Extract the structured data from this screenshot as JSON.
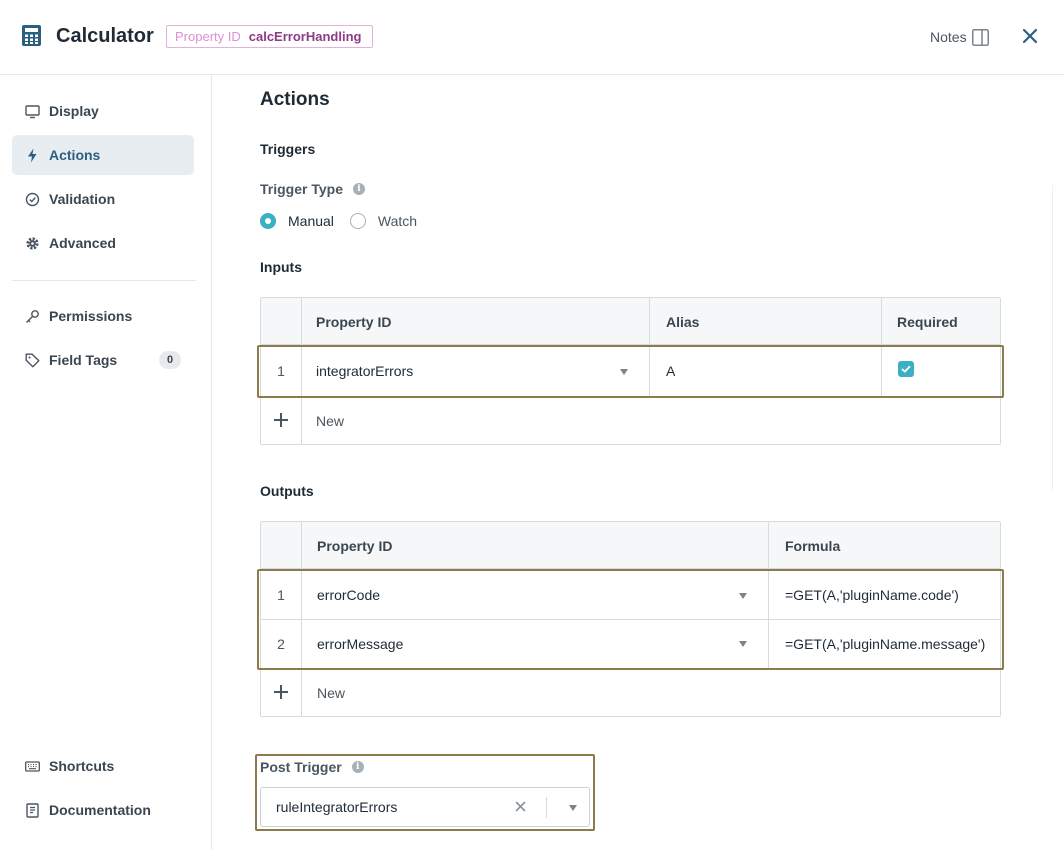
{
  "header": {
    "title": "Calculator",
    "property_key": "Property ID",
    "property_value": "calcErrorHandling",
    "notes_label": "Notes"
  },
  "sidebar": {
    "items": [
      {
        "label": "Display",
        "icon": "monitor-icon"
      },
      {
        "label": "Actions",
        "icon": "lightning-icon",
        "active": true
      },
      {
        "label": "Validation",
        "icon": "check-circle-icon"
      },
      {
        "label": "Advanced",
        "icon": "gear-icon"
      },
      {
        "label": "Permissions",
        "icon": "key-icon"
      },
      {
        "label": "Field Tags",
        "icon": "tag-icon",
        "count": "0"
      },
      {
        "label": "Shortcuts",
        "icon": "keyboard-icon"
      },
      {
        "label": "Documentation",
        "icon": "book-icon"
      }
    ]
  },
  "main": {
    "title": "Actions",
    "triggers_heading": "Triggers",
    "trigger_type_label": "Trigger Type",
    "trigger_options": [
      "Manual",
      "Watch"
    ],
    "trigger_selected": "Manual",
    "inputs": {
      "heading": "Inputs",
      "columns": [
        "Property ID",
        "Alias",
        "Required"
      ],
      "rows": [
        {
          "num": "1",
          "property_id": "integratorErrors",
          "alias": "A",
          "required": true
        }
      ],
      "new_label": "New"
    },
    "outputs": {
      "heading": "Outputs",
      "columns": [
        "Property ID",
        "Formula"
      ],
      "rows": [
        {
          "num": "1",
          "property_id": "errorCode",
          "formula": "=GET(A,'pluginName.code')"
        },
        {
          "num": "2",
          "property_id": "errorMessage",
          "formula": "=GET(A,'pluginName.message')"
        }
      ],
      "new_label": "New"
    },
    "post_trigger": {
      "label": "Post Trigger",
      "value": "ruleIntegratorErrors"
    }
  },
  "colors": {
    "accent": "#3bb0c2",
    "highlight_border": "#8c7b4c",
    "badge_value": "#8e3a86"
  }
}
